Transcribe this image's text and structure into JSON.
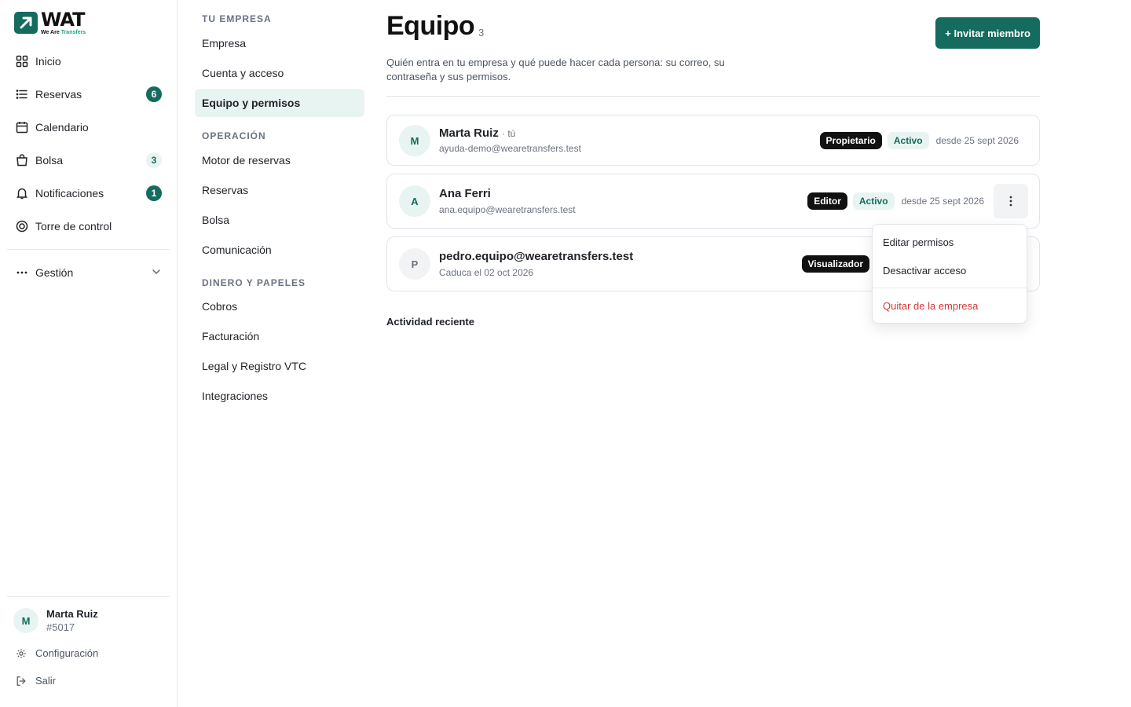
{
  "brand": {
    "word": "WAT",
    "sub_a": "We Are",
    "sub_b": "Transfers",
    "accent": "#146b5e"
  },
  "sidebar": {
    "items": [
      {
        "label": "Inicio",
        "icon": "grid-icon"
      },
      {
        "label": "Reservas",
        "icon": "list-icon",
        "badge": "6"
      },
      {
        "label": "Calendario",
        "icon": "calendar-icon"
      },
      {
        "label": "Bolsa",
        "icon": "bag-icon",
        "badge": "3"
      },
      {
        "label": "Notificaciones",
        "icon": "bell-icon",
        "badge": "1"
      },
      {
        "label": "Torre de control",
        "icon": "target-icon"
      }
    ],
    "management": {
      "label": "Gestión",
      "icon": "dots-icon"
    },
    "user": {
      "initial": "M",
      "name": "Marta Ruiz",
      "id": "#5017"
    },
    "footer": {
      "settings": "Configuración",
      "logout": "Salir"
    }
  },
  "subnav": {
    "groups": [
      {
        "heading": "TU EMPRESA",
        "items": [
          "Empresa",
          "Cuenta y acceso",
          "Equipo y permisos"
        ]
      },
      {
        "heading": "OPERACIÓN",
        "items": [
          "Motor de reservas",
          "Reservas",
          "Bolsa",
          "Comunicación"
        ]
      },
      {
        "heading": "DINERO Y PAPELES",
        "items": [
          "Cobros",
          "Facturación",
          "Legal y Registro VTC",
          "Integraciones"
        ]
      }
    ],
    "active": "Equipo y permisos"
  },
  "main": {
    "title": "Equipo",
    "count": "3",
    "description": "Quién entra en tu empresa y qué puede hacer cada persona: su correo, su contraseña y sus permisos.",
    "invite_label": "+ Invitar miembro",
    "members": [
      {
        "initial": "M",
        "name": "Marta Ruiz",
        "you": "· tú",
        "email": "ayuda-demo@wearetransfers.test",
        "role": "Propietario",
        "status": "Activo",
        "since": "desde 25 sept 2026"
      },
      {
        "initial": "A",
        "name": "Ana Ferri",
        "you": "",
        "email": "ana.equipo@wearetransfers.test",
        "role": "Editor",
        "status": "Activo",
        "since": "desde 25 sept 2026"
      },
      {
        "initial": "P",
        "name": "pedro.equipo@wearetransfers.test",
        "you": "",
        "email": "Caduca el 02 oct 2026",
        "role": "Visualizador",
        "status": "",
        "since": ""
      }
    ],
    "activity_title": "Actividad reciente"
  },
  "menu": {
    "items": [
      "Editar permisos",
      "Desactivar acceso"
    ],
    "danger": "Quitar de la empresa"
  }
}
